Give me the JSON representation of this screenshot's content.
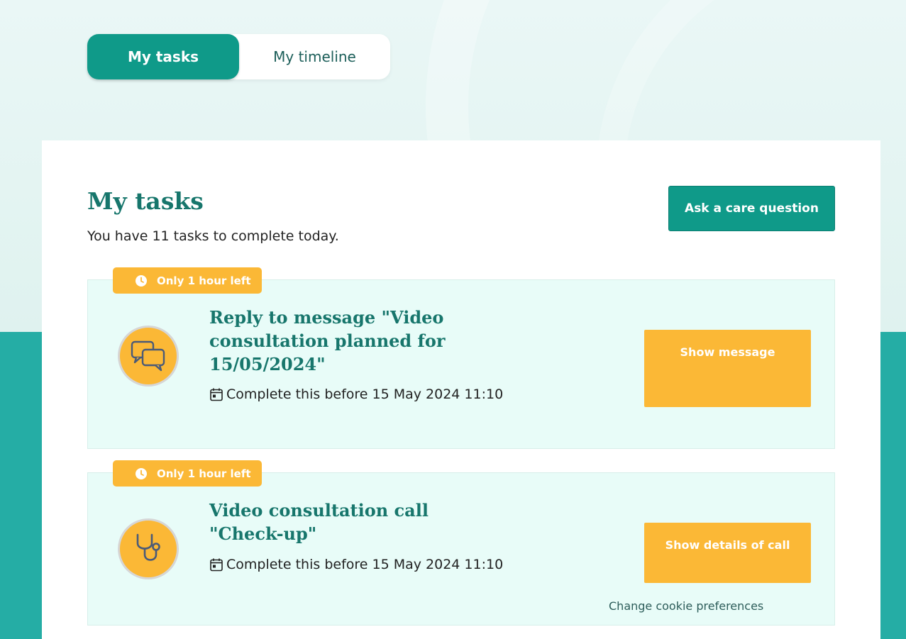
{
  "tabs": [
    {
      "label": "My tasks",
      "active": true
    },
    {
      "label": "My timeline",
      "active": false
    }
  ],
  "main": {
    "title": "My tasks",
    "subtitle": "You have 11 tasks to complete today.",
    "ask_button": "Ask a care question"
  },
  "tasks": [
    {
      "badge": "Only 1 hour left",
      "icon": "chat-bubbles-icon",
      "title": "Reply to message \"Video consultation planned for 15/05/2024\"",
      "deadline": "Complete this before 15 May 2024 11:10",
      "button": "Show message"
    },
    {
      "badge": "Only 1 hour left",
      "icon": "stethoscope-icon",
      "title": "Video consultation call \"Check-up\"",
      "deadline": "Complete this before 15 May 2024 11:10",
      "button": "Show details of call"
    }
  ],
  "cookie_link": "Change cookie preferences",
  "colors": {
    "primary": "#0f9a89",
    "accent": "#fbb836",
    "heading": "#17766c",
    "task_bg": "#e8fcf8",
    "lower_bg": "#25ada5"
  }
}
